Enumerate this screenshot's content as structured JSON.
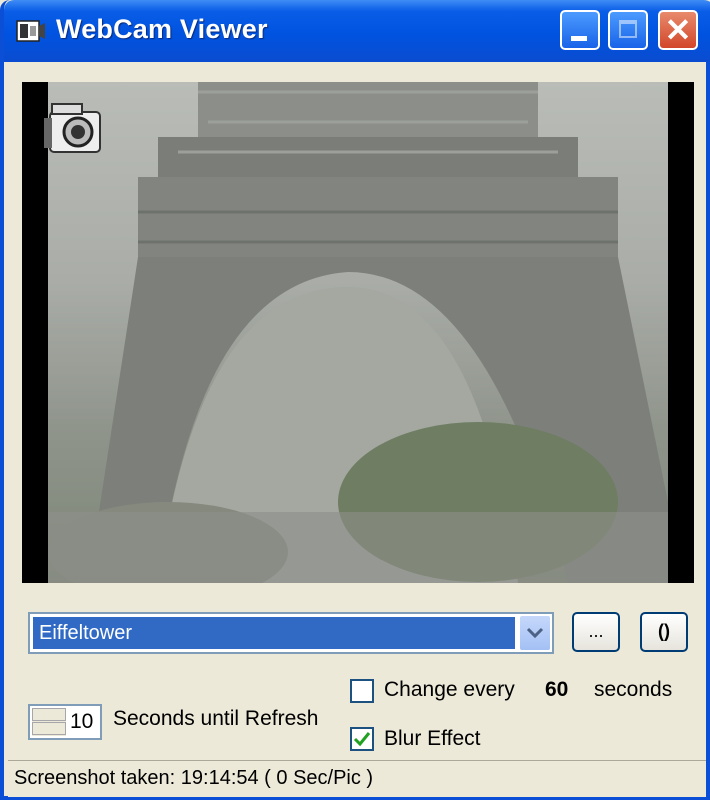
{
  "window": {
    "title": "WebCam Viewer",
    "app_icon": "film-camera-icon",
    "controls": [
      "minimize-icon",
      "maximize-icon",
      "close-icon"
    ]
  },
  "camera": {
    "overlay_icon": "camera-icon",
    "description": ""
  },
  "camera_select": {
    "value": "Eiffeltower"
  },
  "buttons": {
    "browse_label": "...",
    "refresh_label": "()"
  },
  "options": {
    "change_every_label": "Change every",
    "change_every_checked": false,
    "interval_value": "60",
    "seconds_label": "seconds",
    "blur_label": "Blur Effect",
    "blur_checked": true
  },
  "refresh": {
    "spinner_value": "10",
    "label": "Seconds until Refresh"
  },
  "status": {
    "text": "Screenshot taken: 19:14:54 ( 0 Sec/Pic )"
  },
  "colors": {
    "titlebar": "#0053e0",
    "selection": "#316ac5",
    "window_bg": "#ece9d8"
  }
}
